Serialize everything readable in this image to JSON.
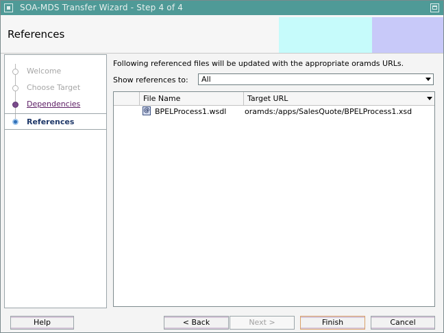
{
  "window": {
    "title": "SOA-MDS Transfer Wizard - Step 4 of 4"
  },
  "header": {
    "title": "References"
  },
  "nav": {
    "items": [
      {
        "label": "Welcome",
        "state": "disabled"
      },
      {
        "label": "Choose Target",
        "state": "disabled"
      },
      {
        "label": "Dependencies",
        "state": "link"
      },
      {
        "label": "References",
        "state": "current"
      }
    ]
  },
  "content": {
    "description": "Following referenced files will be updated with the appropriate oramds URLs.",
    "show_label": "Show references to:",
    "show_value": "All",
    "table": {
      "columns": [
        "File Name",
        "Target URL"
      ],
      "rows": [
        {
          "icon": "wsdl-file-icon",
          "file_name": "BPELProcess1.wsdl",
          "target_url": "oramds:/apps/SalesQuote/BPELProcess1.xsd"
        }
      ]
    }
  },
  "buttons": {
    "help": "Help",
    "back": "< Back",
    "next": "Next >",
    "finish": "Finish",
    "cancel": "Cancel"
  },
  "colors": {
    "titlebar": "#4f9a97",
    "header_band_cyan": "#c6fbfb",
    "header_band_lavender": "#c8c9f9",
    "nav_link": "#5a1a62",
    "nav_current": "#1e3768",
    "nav_dot_active": "#7a4c8c",
    "nav_dot_current": "#2f6fb8"
  }
}
